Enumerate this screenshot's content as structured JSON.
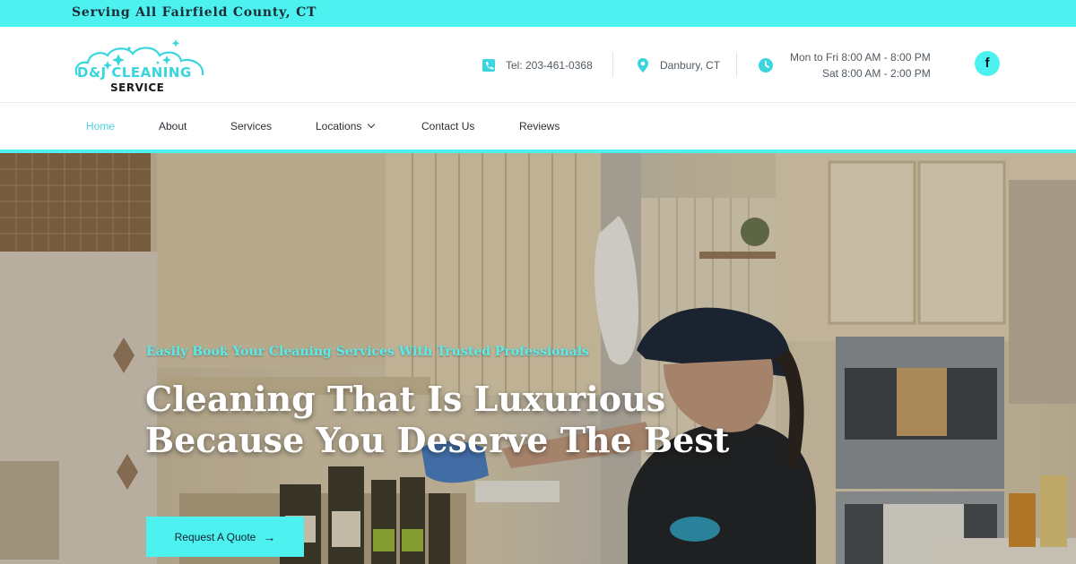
{
  "topbar": {
    "tagline": "Serving All Fairfield County, CT"
  },
  "logo": {
    "line1": "D&J CLEANING",
    "line2": "SERVICE"
  },
  "contact": {
    "phone": "Tel: 203-461-0368",
    "location": "Danbury, CT",
    "hours_weekday": "Mon to Fri 8:00 AM - 8:00 PM",
    "hours_saturday": "Sat 8:00 AM - 2:00 PM"
  },
  "social": {
    "facebook": "f"
  },
  "nav": {
    "home": "Home",
    "about": "About",
    "services": "Services",
    "locations": "Locations",
    "contact": "Contact Us",
    "reviews": "Reviews"
  },
  "hero": {
    "kicker": "Easily Book Your Cleaning Services With Trusted Professionals",
    "heading_line1": "Cleaning That Is Luxurious",
    "heading_line2": "Because You Deserve The Best",
    "cta_label": "Request A Quote",
    "cta_arrow": "→"
  },
  "colors": {
    "accent": "#4df1f0",
    "accent_text": "#4fd4dc",
    "dark": "#1d2b36"
  },
  "icons": [
    "phone-icon",
    "location-pin-icon",
    "clock-icon",
    "facebook-icon",
    "chevron-down-icon",
    "arrow-right-icon",
    "sparkle-icon"
  ]
}
